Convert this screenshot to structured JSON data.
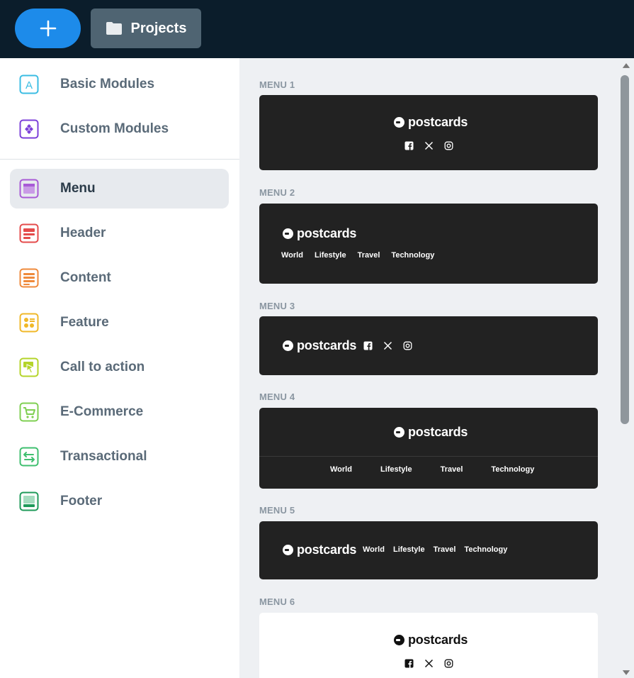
{
  "topbar": {
    "projects_label": "Projects",
    "colors": {
      "bg": "#0b1d2b",
      "add_button": "#1d8bea",
      "projects_button": "#4f6472"
    }
  },
  "sidebar": {
    "items": [
      {
        "label": "Basic Modules",
        "icon": "basic-modules-icon",
        "color": "#3bbde3"
      },
      {
        "label": "Custom Modules",
        "icon": "custom-modules-icon",
        "color": "#7b3fd9"
      },
      {
        "label": "Menu",
        "icon": "menu-icon",
        "color": "#a85bd6",
        "active": true
      },
      {
        "label": "Header",
        "icon": "header-icon",
        "color": "#e44b4b"
      },
      {
        "label": "Content",
        "icon": "content-icon",
        "color": "#ef8a3b"
      },
      {
        "label": "Feature",
        "icon": "feature-icon",
        "color": "#f0b829"
      },
      {
        "label": "Call to action",
        "icon": "call-to-action-icon",
        "color": "#b4d42a"
      },
      {
        "label": "E-Commerce",
        "icon": "ecommerce-icon",
        "color": "#7fcf52"
      },
      {
        "label": "Transactional",
        "icon": "transactional-icon",
        "color": "#3fbf6f"
      },
      {
        "label": "Footer",
        "icon": "footer-icon",
        "color": "#1f9a5a"
      }
    ]
  },
  "main": {
    "brand": "postcards",
    "nav_links": [
      "World",
      "Lifestyle",
      "Travel",
      "Technology"
    ],
    "menus": [
      {
        "label": "MENU 1"
      },
      {
        "label": "MENU 2"
      },
      {
        "label": "MENU 3"
      },
      {
        "label": "MENU 4"
      },
      {
        "label": "MENU 5"
      },
      {
        "label": "MENU 6"
      }
    ]
  }
}
